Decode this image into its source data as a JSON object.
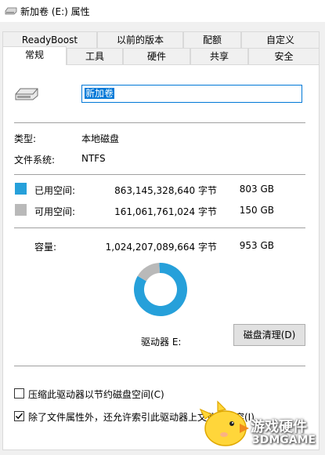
{
  "window": {
    "title": "新加卷 (E:) 属性"
  },
  "tabs_back": [
    "ReadyBoost",
    "以前的版本",
    "配额",
    "自定义"
  ],
  "tabs_front": [
    "常规",
    "工具",
    "硬件",
    "共享",
    "安全"
  ],
  "active_tab": "常规",
  "volume_name": "新加卷",
  "info": {
    "type_label": "类型:",
    "type_value": "本地磁盘",
    "fs_label": "文件系统:",
    "fs_value": "NTFS"
  },
  "space": {
    "used_label": "已用空间:",
    "used_bytes": "863,145,328,640 字节",
    "used_gb": "803 GB",
    "free_label": "可用空间:",
    "free_bytes": "161,061,761,024 字节",
    "free_gb": "150 GB",
    "capacity_label": "容量:",
    "capacity_bytes": "1,024,207,089,664 字节",
    "capacity_gb": "953 GB"
  },
  "chart_data": {
    "type": "pie",
    "categories": [
      "已用空间",
      "可用空间"
    ],
    "values": [
      803,
      150
    ],
    "colors": [
      "#26a0da",
      "#b9b9b9"
    ]
  },
  "drive_label": "驱动器 E:",
  "cleanup_button": "磁盘清理(D)",
  "options": {
    "compress_label": "压缩此驱动器以节约磁盘空间(C)",
    "compress_checked": false,
    "index_label": "除了文件属性外，还允许索引此驱动器上文件的内容(I)",
    "index_checked": true
  },
  "watermark": {
    "line1": "游戏硬件",
    "line2": "3DMGAME"
  },
  "colors": {
    "used": "#26a0da",
    "free": "#b9b9b9",
    "accent": "#0078d7"
  }
}
